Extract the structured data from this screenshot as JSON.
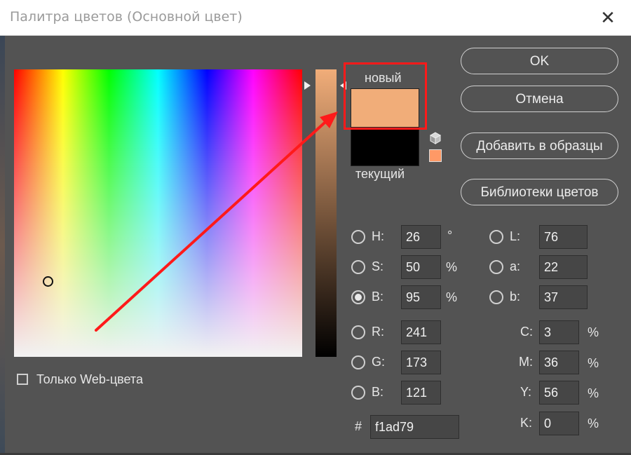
{
  "window": {
    "title": "Палитра цветов (Основной цвет)",
    "close_glyph": "✕"
  },
  "swatches": {
    "new_label": "новый",
    "current_label": "текущий",
    "new_color": "#f1ad79",
    "current_color": "#000000"
  },
  "buttons": {
    "ok": "OK",
    "cancel": "Отмена",
    "add_to_swatches": "Добавить в образцы",
    "color_libraries": "Библиотеки цветов"
  },
  "hsb": {
    "h": {
      "label": "H:",
      "value": "26",
      "unit": "°"
    },
    "s": {
      "label": "S:",
      "value": "50",
      "unit": "%"
    },
    "b": {
      "label": "B:",
      "value": "95",
      "unit": "%"
    }
  },
  "rgb": {
    "r": {
      "label": "R:",
      "value": "241"
    },
    "g": {
      "label": "G:",
      "value": "173"
    },
    "b": {
      "label": "B:",
      "value": "121"
    }
  },
  "lab": {
    "l": {
      "label": "L:",
      "value": "76"
    },
    "a": {
      "label": "a:",
      "value": "22"
    },
    "b": {
      "label": "b:",
      "value": "37"
    }
  },
  "cmyk": {
    "c": {
      "label": "C:",
      "value": "3",
      "unit": "%"
    },
    "m": {
      "label": "M:",
      "value": "36",
      "unit": "%"
    },
    "y": {
      "label": "Y:",
      "value": "56",
      "unit": "%"
    },
    "k": {
      "label": "K:",
      "value": "0",
      "unit": "%"
    }
  },
  "hex": {
    "label": "#",
    "value": "f1ad79"
  },
  "web_only": {
    "label": "Только Web-цвета",
    "checked": false
  },
  "selected_channel": "B",
  "annotation": {
    "box_color": "#ff1a1a",
    "arrow_color": "#ff1a1a"
  },
  "icons": {
    "gamut_warning": "cube-icon",
    "web_safe": "websafe-swatch-icon"
  }
}
